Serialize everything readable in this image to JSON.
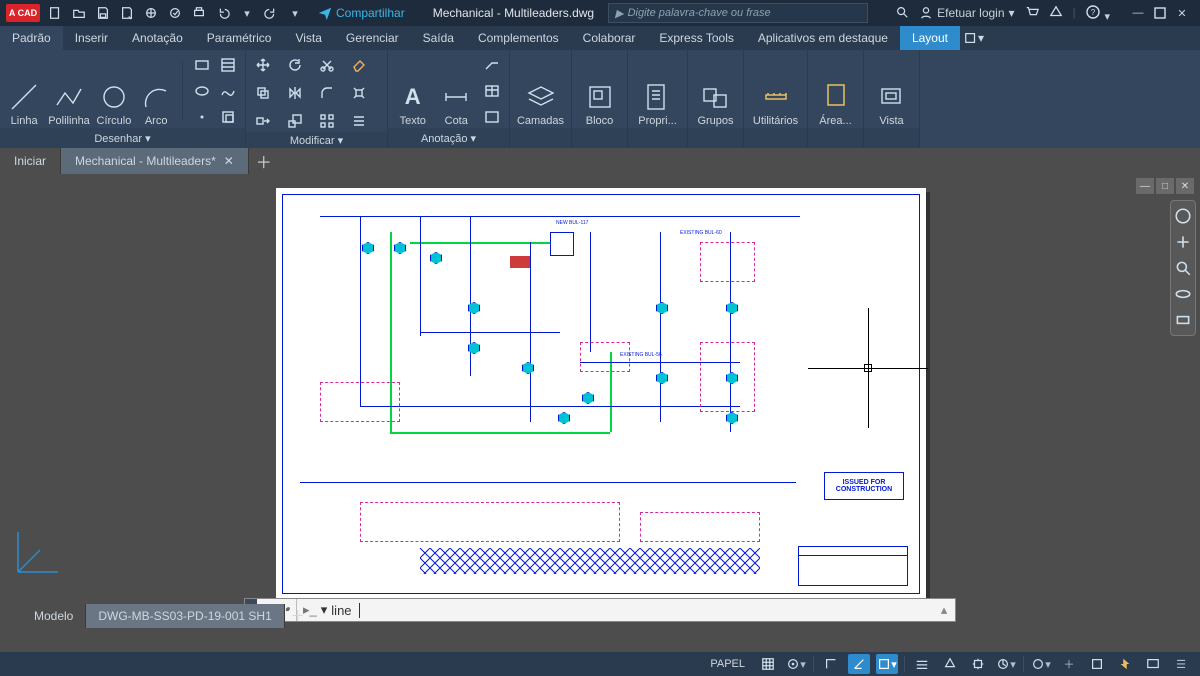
{
  "app": {
    "badge": "A CAD",
    "share": "Compartilhar",
    "title": "Mechanical - Multileaders.dwg"
  },
  "search": {
    "placeholder": "Digite palavra-chave ou frase"
  },
  "account": {
    "login": "Efetuar login"
  },
  "menu": {
    "tabs": [
      "Padrão",
      "Inserir",
      "Anotação",
      "Paramétrico",
      "Vista",
      "Gerenciar",
      "Saída",
      "Complementos",
      "Colaborar",
      "Express Tools",
      "Aplicativos em destaque",
      "Layout"
    ],
    "active": 0,
    "highlight_index": 11
  },
  "ribbon": {
    "panels": [
      {
        "title": "Desenhar ▾",
        "big": [
          {
            "label": "Linha"
          },
          {
            "label": "Polilinha"
          },
          {
            "label": "Círculo"
          },
          {
            "label": "Arco"
          }
        ],
        "small_cols": 2
      },
      {
        "title": "Modificar ▾",
        "big": [],
        "cols": 4,
        "rows": 3
      },
      {
        "title": "Anotação ▾",
        "big": [
          {
            "label": "Texto"
          },
          {
            "label": "Cota"
          }
        ],
        "small_cols": 1
      },
      {
        "title": "",
        "big": [
          {
            "label": "Camadas"
          }
        ]
      },
      {
        "title": "",
        "big": [
          {
            "label": "Bloco"
          }
        ]
      },
      {
        "title": "",
        "big": [
          {
            "label": "Propri..."
          }
        ]
      },
      {
        "title": "",
        "big": [
          {
            "label": "Grupos"
          }
        ]
      },
      {
        "title": "",
        "big": [
          {
            "label": "Utilitários"
          }
        ]
      },
      {
        "title": "",
        "big": [
          {
            "label": "Área..."
          }
        ]
      },
      {
        "title": "",
        "big": [
          {
            "label": "Vista"
          }
        ]
      }
    ]
  },
  "filetabs": {
    "start": "Iniciar",
    "items": [
      "Mechanical - Multileaders*"
    ],
    "active": 0
  },
  "model_tabs": {
    "model": "Modelo",
    "layouts": [
      "DWG-MB-SS03-PD-19-001 SH1"
    ],
    "active_layout": 0
  },
  "command": {
    "text": "line"
  },
  "statusbar": {
    "space": "PAPEL"
  },
  "drawing": {
    "stamp_line1": "ISSUED FOR",
    "stamp_line2": "CONSTRUCTION",
    "labels": {
      "new_bul": "NEW BUL-117",
      "exist_bul": "EXISTING BUL-60",
      "exist_bul2": "EXISTING BUL-56"
    }
  }
}
